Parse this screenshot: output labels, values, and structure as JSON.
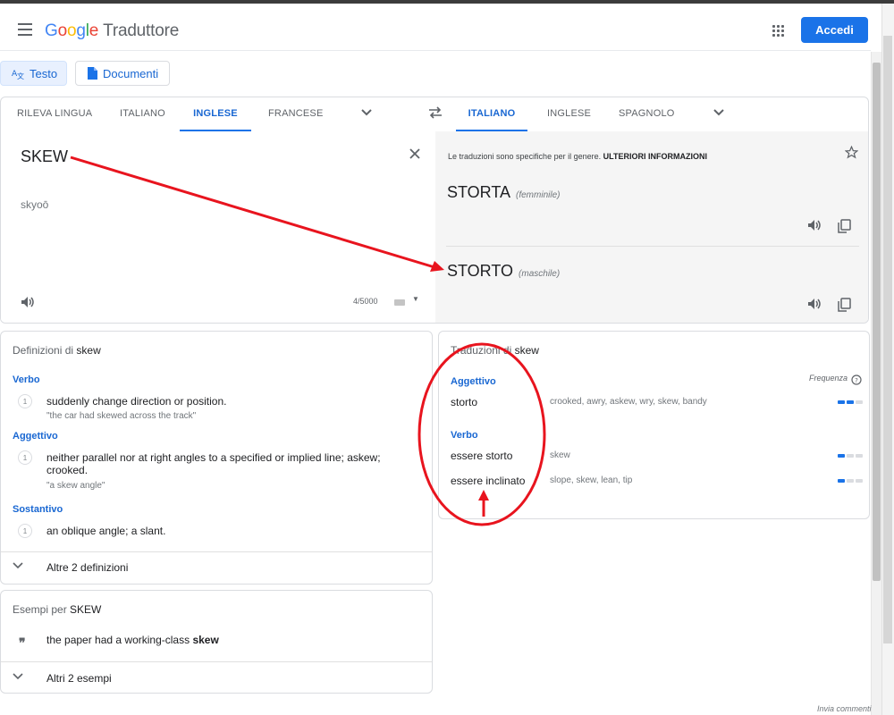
{
  "header": {
    "logo_letters": [
      "G",
      "o",
      "o",
      "g",
      "l",
      "e"
    ],
    "product_name": "Traduttore",
    "signin_label": "Accedi"
  },
  "modes": {
    "text_label": "Testo",
    "documents_label": "Documenti"
  },
  "source_languages": {
    "items": [
      "RILEVA LINGUA",
      "ITALIANO",
      "INGLESE",
      "FRANCESE"
    ],
    "active": "INGLESE"
  },
  "target_languages": {
    "items": [
      "ITALIANO",
      "INGLESE",
      "SPAGNOLO"
    ],
    "active": "ITALIANO"
  },
  "source": {
    "text": "SKEW",
    "transliteration": "skyoō",
    "char_count": "4/5000"
  },
  "target": {
    "note": "Le traduzioni sono specifiche per il genere.",
    "note_link": "ULTERIORI INFORMAZIONI",
    "translations": [
      {
        "word": "STORTA",
        "gender": "(femminile)"
      },
      {
        "word": "STORTO",
        "gender": "(maschile)"
      }
    ]
  },
  "definitions": {
    "title_prefix": "Definizioni di",
    "title_word": "skew",
    "groups": [
      {
        "pos": "Verbo",
        "entries": [
          {
            "num": "1",
            "text": "suddenly change direction or position.",
            "example": "\"the car had skewed across the track\""
          }
        ]
      },
      {
        "pos": "Aggettivo",
        "entries": [
          {
            "num": "1",
            "text": "neither parallel nor at right angles to a specified or implied line; askew; crooked.",
            "example": "\"a skew angle\""
          }
        ]
      },
      {
        "pos": "Sostantivo",
        "entries": [
          {
            "num": "1",
            "text": "an oblique angle; a slant.",
            "example": ""
          }
        ]
      }
    ],
    "more_label": "Altre 2 definizioni"
  },
  "examples": {
    "title_prefix": "Esempi per",
    "title_word": "SKEW",
    "sentence_prefix": "the paper had a working-class",
    "sentence_bold": "skew",
    "more_label": "Altri 2 esempi"
  },
  "translations_card": {
    "title_prefix": "Traduzioni di",
    "title_word": "skew",
    "frequency_label": "Frequenza",
    "groups": [
      {
        "pos": "Aggettivo",
        "rows": [
          {
            "word": "storto",
            "synonyms": "crooked, awry, askew, wry, skew, bandy",
            "frequency": 2
          }
        ]
      },
      {
        "pos": "Verbo",
        "rows": [
          {
            "word": "essere storto",
            "synonyms": "skew",
            "frequency": 1
          },
          {
            "word": "essere inclinato",
            "synonyms": "slope, skew, lean, tip",
            "frequency": 1
          }
        ]
      }
    ]
  },
  "footer": {
    "feedback_label": "Invia commenti"
  },
  "icons": [
    "menu-icon",
    "apps-icon",
    "translate-icon",
    "document-icon",
    "chevron-down-icon",
    "swap-icon",
    "close-icon",
    "speaker-icon",
    "keyboard-icon",
    "star-icon",
    "copy-icon",
    "help-icon",
    "quote-icon"
  ],
  "colors": {
    "accent": "#1a73e8",
    "annotation_red": "#e8141e"
  }
}
